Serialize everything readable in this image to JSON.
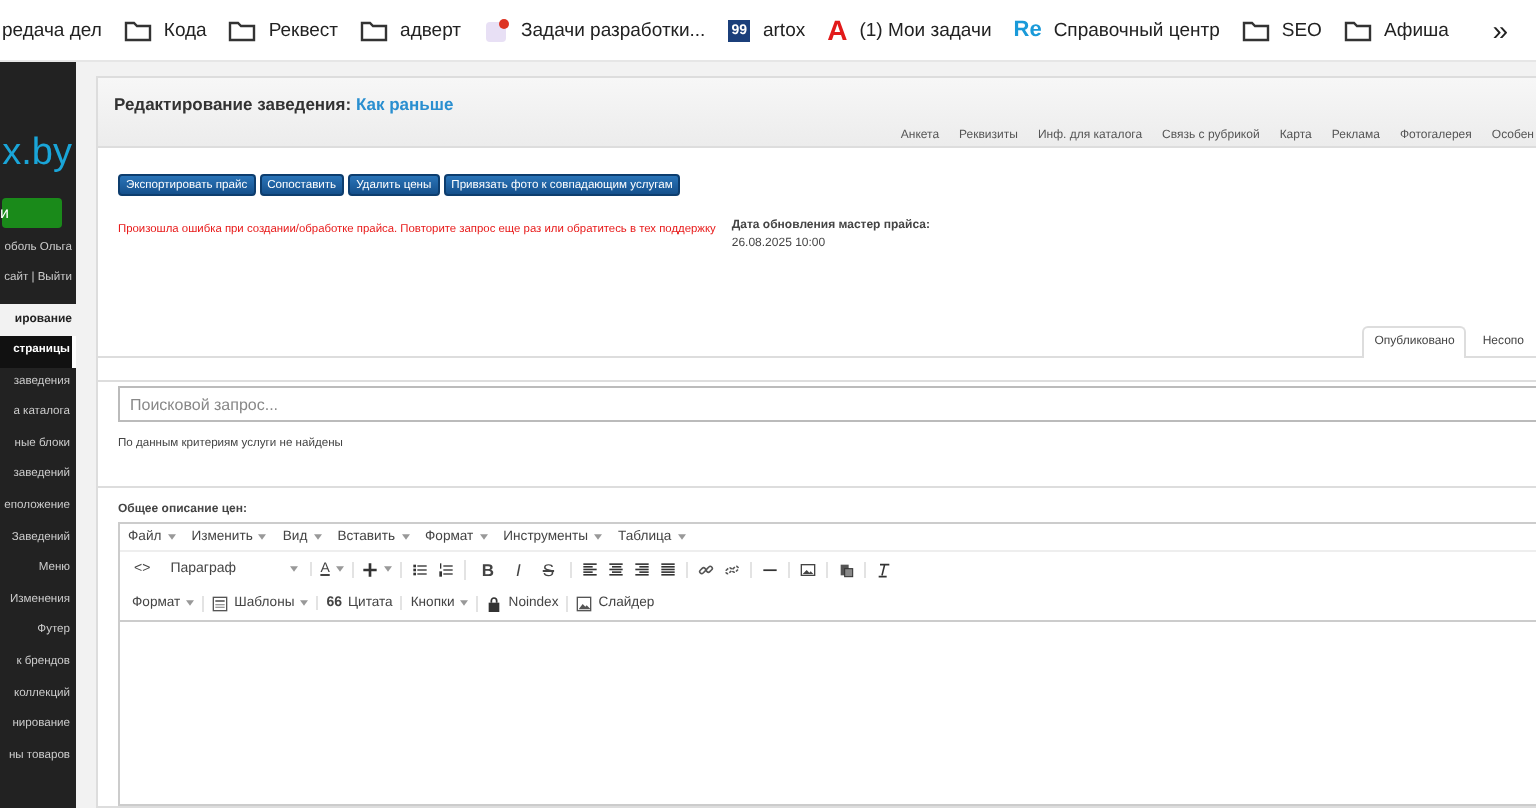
{
  "bookmarks": [
    {
      "kind": "plain",
      "label": "редача дел"
    },
    {
      "kind": "folder",
      "label": "Кода"
    },
    {
      "kind": "folder",
      "label": "Реквест"
    },
    {
      "kind": "folder",
      "label": "адверт"
    },
    {
      "kind": "app",
      "label": "Задачи разработки..."
    },
    {
      "kind": "badge",
      "label": "artox",
      "badge": "99"
    },
    {
      "kind": "letter",
      "label": "(1) Мои задачи",
      "badge": "A"
    },
    {
      "kind": "re",
      "label": "Справочный центр",
      "badge": "Re"
    },
    {
      "kind": "folder",
      "label": "SEO"
    },
    {
      "kind": "folder",
      "label": "Афиша"
    }
  ],
  "bookmarks_more": "»",
  "sidebar": {
    "logo": "x.by",
    "button": "и",
    "user": "оболь Ольга",
    "links": "сайт | Выйти",
    "section": "ирование",
    "items": [
      {
        "label": "страницы",
        "selected": true
      },
      {
        "label": "заведения",
        "selected": false
      },
      {
        "label": "а каталога",
        "selected": false
      },
      {
        "label": "ные блоки",
        "selected": false
      },
      {
        "label": "заведений",
        "selected": false
      },
      {
        "label": "еположение",
        "selected": false
      },
      {
        "label": "Заведений",
        "selected": false
      },
      {
        "label": "Меню",
        "selected": false
      },
      {
        "label": "Изменения",
        "selected": false
      },
      {
        "label": "Футер",
        "selected": false
      },
      {
        "label": "к брендов",
        "selected": false
      },
      {
        "label": "коллекций",
        "selected": false
      },
      {
        "label": "нирование",
        "selected": false
      },
      {
        "label": "ны товаров",
        "selected": false
      }
    ]
  },
  "header": {
    "title": "Редактирование заведения:",
    "link": "Как раньше",
    "tabs": [
      "Анкета",
      "Реквизиты",
      "Инф. для каталога",
      "Связь с рубрикой",
      "Карта",
      "Реклама",
      "Фотогалерея",
      "Особен"
    ]
  },
  "actions": [
    "Экспортировать прайс",
    "Сопоставить",
    "Удалить цены",
    "Привязать фото к совпадающим услугам"
  ],
  "error": "Произошла ошибка при создании/обработке прайса. Повторите запрос еще раз или обратитесь в тех поддержку",
  "update": {
    "label": "Дата обновления мастер прайса:",
    "value": "26.08.2025 10:00"
  },
  "status_tabs": [
    {
      "label": "Опубликовано",
      "selected": true
    },
    {
      "label": "Несопо",
      "selected": false
    }
  ],
  "search": {
    "placeholder": "Поисковой запрос..."
  },
  "no_results": "По данным критериям услуги не найдены",
  "editor": {
    "label": "Общее описание цен:",
    "menu": [
      "Файл",
      "Изменить",
      "Вид",
      "Вставить",
      "Формат",
      "Инструменты",
      "Таблица"
    ],
    "toolbar": {
      "code": "<>",
      "block": "Параграф",
      "font_color_button": "A",
      "bold": "B",
      "italic": "I",
      "strike": "S"
    },
    "toolbar2": [
      {
        "kind": "menu",
        "label": "Формат"
      },
      {
        "kind": "templates",
        "label": "Шаблоны"
      },
      {
        "kind": "quote",
        "label": "Цитата",
        "mark": "66"
      },
      {
        "kind": "menu",
        "label": "Кнопки"
      },
      {
        "kind": "lock",
        "label": "Noindex"
      },
      {
        "kind": "image",
        "label": "Слайдер"
      }
    ]
  }
}
